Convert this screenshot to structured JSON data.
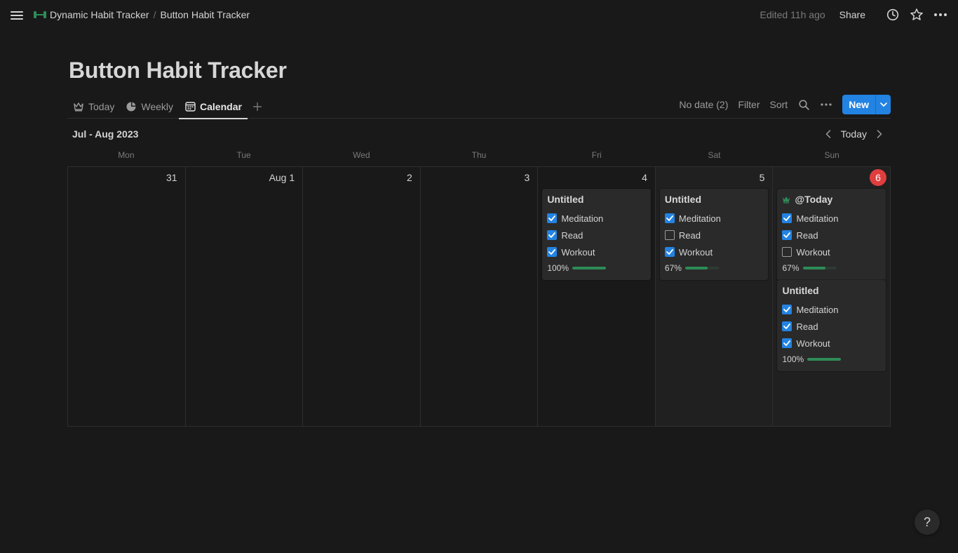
{
  "breadcrumb": {
    "parent": "Dynamic Habit Tracker",
    "separator": "/",
    "current": "Button Habit Tracker"
  },
  "topbar": {
    "edited": "Edited 11h ago",
    "share": "Share"
  },
  "page": {
    "title": "Button Habit Tracker"
  },
  "views": {
    "tabs": [
      {
        "label": "Today",
        "icon": "crown-icon",
        "active": false
      },
      {
        "label": "Weekly",
        "icon": "pie-chart-icon",
        "active": false
      },
      {
        "label": "Calendar",
        "icon": "calendar-icon",
        "active": true
      }
    ],
    "no_date": "No date (2)",
    "filter": "Filter",
    "sort": "Sort",
    "new_label": "New"
  },
  "calendar": {
    "month_label": "Jul - Aug 2023",
    "today_label": "Today",
    "weekdays": [
      "Mon",
      "Tue",
      "Wed",
      "Thu",
      "Fri",
      "Sat",
      "Sun"
    ],
    "days": [
      {
        "num": "31",
        "cards": []
      },
      {
        "num": "Aug 1",
        "cards": []
      },
      {
        "num": "2",
        "cards": []
      },
      {
        "num": "3",
        "cards": []
      },
      {
        "num": "4",
        "cards": [
          {
            "title": "Untitled",
            "bolt": false,
            "habits": [
              {
                "label": "Meditation",
                "done": true
              },
              {
                "label": "Read",
                "done": true
              },
              {
                "label": "Workout",
                "done": true
              }
            ],
            "progress_label": "100%",
            "progress": 1.0
          }
        ]
      },
      {
        "num": "5",
        "cards": [
          {
            "title": "Untitled",
            "bolt": false,
            "habits": [
              {
                "label": "Meditation",
                "done": true
              },
              {
                "label": "Read",
                "done": false
              },
              {
                "label": "Workout",
                "done": true
              }
            ],
            "progress_label": "67%",
            "progress": 0.67
          }
        ]
      },
      {
        "num": "6",
        "today": true,
        "cards": [
          {
            "title": "@Today",
            "bolt": true,
            "habits": [
              {
                "label": "Meditation",
                "done": true
              },
              {
                "label": "Read",
                "done": true
              },
              {
                "label": "Workout",
                "done": false
              }
            ],
            "progress_label": "67%",
            "progress": 0.67
          },
          {
            "title": "Untitled",
            "bolt": false,
            "habits": [
              {
                "label": "Meditation",
                "done": true
              },
              {
                "label": "Read",
                "done": true
              },
              {
                "label": "Workout",
                "done": true
              }
            ],
            "progress_label": "100%",
            "progress": 1.0
          }
        ]
      }
    ]
  },
  "help": {
    "label": "?"
  },
  "colors": {
    "accent": "#2383e2",
    "progress": "#2e8b57",
    "today_badge": "#e03e3e",
    "background": "#191919"
  }
}
